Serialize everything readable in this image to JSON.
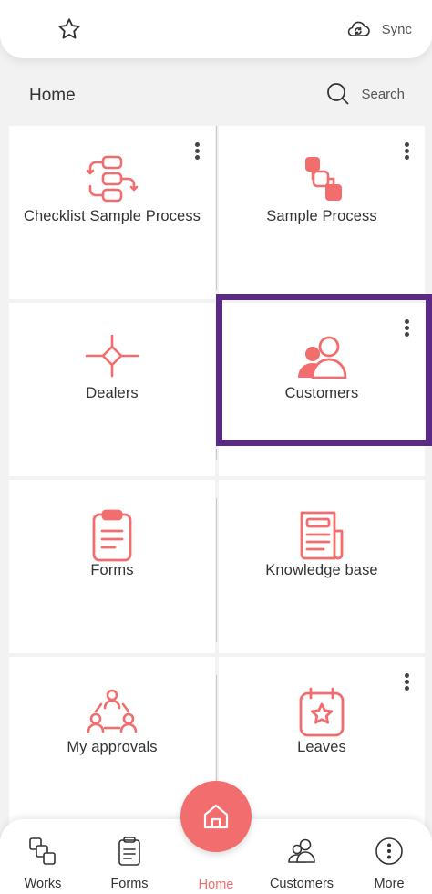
{
  "topbar": {
    "sync_label": "Sync"
  },
  "header": {
    "title": "Home",
    "search_label": "Search"
  },
  "tiles": [
    {
      "label": "Checklist Sample Process",
      "icon": "process-flow-icon",
      "has_menu": true
    },
    {
      "label": "Sample Process",
      "icon": "sample-process-icon",
      "has_menu": true
    },
    {
      "label": "Dealers",
      "icon": "diamond-network-icon",
      "has_menu": false
    },
    {
      "label": "Customers",
      "icon": "customers-icon",
      "has_menu": true
    },
    {
      "label": "Forms",
      "icon": "clipboard-icon",
      "has_menu": false
    },
    {
      "label": "Knowledge base",
      "icon": "newspaper-icon",
      "has_menu": false
    },
    {
      "label": "My approvals",
      "icon": "approvals-icon",
      "has_menu": false
    },
    {
      "label": "Leaves",
      "icon": "calendar-star-icon",
      "has_menu": true
    }
  ],
  "nav": {
    "works": "Works",
    "forms": "Forms",
    "home": "Home",
    "customers": "Customers",
    "more": "More"
  },
  "colors": {
    "accent": "#f26d6d",
    "highlight": "#5a2a86"
  }
}
